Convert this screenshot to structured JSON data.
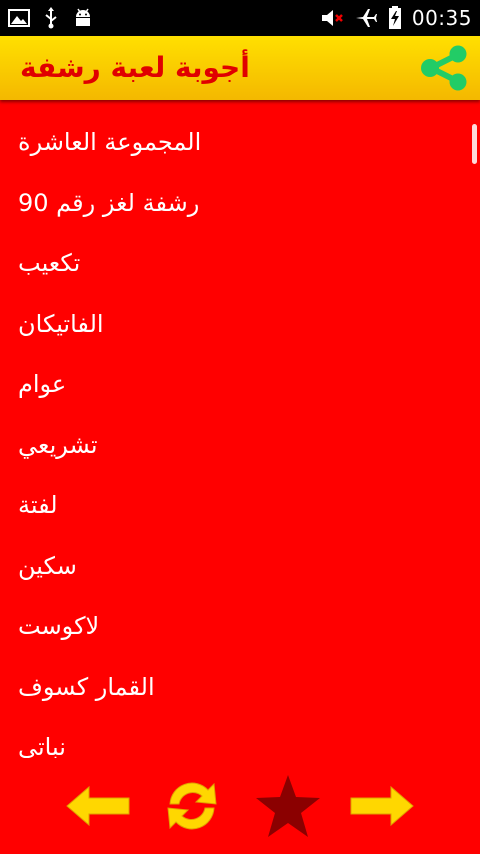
{
  "status_bar": {
    "time": "00:35",
    "left_icons": [
      "image-icon",
      "usb-icon",
      "android-icon"
    ],
    "right_icons": [
      "volume-muted-icon",
      "airplane-mode-icon",
      "battery-charging-icon"
    ]
  },
  "header": {
    "title": "أجوبة لعبة رشفة",
    "share_icon": "share-icon",
    "title_color": "#e00000",
    "background": "#ffd800",
    "share_color": "#22cc66"
  },
  "list": {
    "items": [
      "المجموعة العاشرة",
      "رشفة لغز رقم 90",
      "تكعيب",
      "الفاتيكان",
      "عوام",
      "تشريعي",
      "لفتة",
      "سكين",
      "لاكوست",
      "القمار كسوف",
      "نباتي"
    ]
  },
  "bottom_bar": {
    "buttons": [
      "arrow-left-icon",
      "refresh-icon",
      "star-icon",
      "arrow-right-icon"
    ],
    "arrow_color": "#ffd700",
    "star_color": "#8b0000"
  },
  "colors": {
    "background": "#ff0000",
    "text": "#ffffff"
  }
}
